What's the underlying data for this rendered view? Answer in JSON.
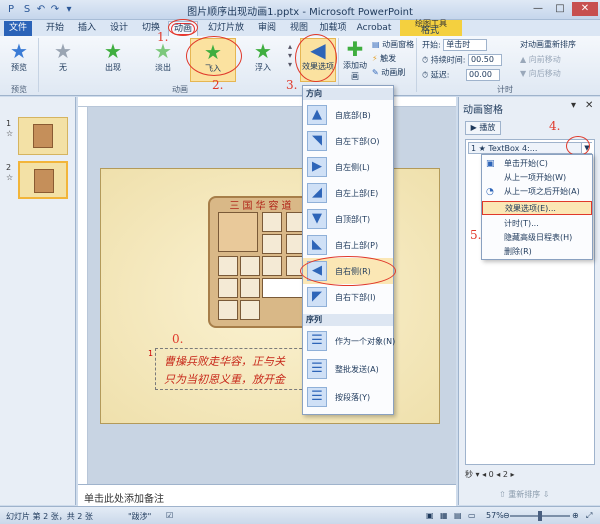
{
  "titlebar": {
    "title": "图片顺序出现动画1.pptx - Microsoft PowerPoint",
    "qat": [
      "P",
      "S",
      "↶",
      "↷",
      "▾"
    ],
    "window_controls": [
      "—",
      "□",
      "✕"
    ]
  },
  "tabs": {
    "file": "文件",
    "items": [
      "开始",
      "插入",
      "设计",
      "切换",
      "动画",
      "幻灯片放映",
      "审阅",
      "视图",
      "加载项",
      "Acrobat",
      "格式"
    ],
    "tool_group": "绘图工具"
  },
  "ribbon": {
    "preview": "预览",
    "preview_group": "预览",
    "effects": [
      "无",
      "出现",
      "淡出",
      "飞入",
      "浮入"
    ],
    "effect_options": "效果选项",
    "add_animation": "添加动画",
    "animation_group": "动画",
    "advanced": [
      "动画窗格",
      "触发",
      "动画刷"
    ],
    "timing": {
      "start_label": "开始:",
      "start_value": "单击时",
      "duration_label": "持续时间:",
      "duration_value": "00.50",
      "delay_label": "延迟:",
      "delay_value": "00.00",
      "group": "计时"
    },
    "reorder": {
      "title": "对动画重新排序",
      "earlier": "向前移动",
      "later": "向后移动"
    }
  },
  "annotations": {
    "n1": "1.",
    "n2": "2.",
    "n3": "3.",
    "n4": "4.",
    "n5": "5.",
    "n0": "0."
  },
  "slides": {
    "thumbs": [
      {
        "num": "1",
        "star": "☆"
      },
      {
        "num": "2",
        "star": "☆"
      }
    ]
  },
  "slide": {
    "puzzle_title": "三国华容道",
    "text_line1": "曹操兵败走华容，正与关",
    "text_line2": "只为当初恩义重，放开金",
    "text_index": "1"
  },
  "dropdown": {
    "direction_head": "方向",
    "directions": [
      {
        "label": "自底部(B)",
        "icon": "arrow-up-icon",
        "glyph": "▲"
      },
      {
        "label": "自左下部(O)",
        "icon": "arrow-up-right-icon",
        "glyph": "◥"
      },
      {
        "label": "自左侧(L)",
        "icon": "arrow-right-icon",
        "glyph": "▶"
      },
      {
        "label": "自左上部(E)",
        "icon": "arrow-down-right-icon",
        "glyph": "◢"
      },
      {
        "label": "自顶部(T)",
        "icon": "arrow-down-icon",
        "glyph": "▼"
      },
      {
        "label": "自右上部(P)",
        "icon": "arrow-down-left-icon",
        "glyph": "◣"
      },
      {
        "label": "自右侧(R)",
        "icon": "arrow-left-icon",
        "glyph": "◀"
      },
      {
        "label": "自右下部(I)",
        "icon": "arrow-up-left-icon",
        "glyph": "◤"
      }
    ],
    "sequence_head": "序列",
    "sequences": [
      {
        "label": "作为一个对象(N)",
        "icon": "lines-icon",
        "glyph": "☰"
      },
      {
        "label": "整批发送(A)",
        "icon": "lines-icon",
        "glyph": "☰"
      },
      {
        "label": "按段落(Y)",
        "icon": "lines-icon",
        "glyph": "☰"
      }
    ]
  },
  "anim_pane": {
    "title": "动画窗格",
    "play": "▶ 播放",
    "item": "1 ★ TextBox 4:...",
    "context_menu": [
      {
        "label": "单击开始(C)",
        "glyph": "🖱"
      },
      {
        "label": "从上一项开始(W)",
        "glyph": ""
      },
      {
        "label": "从上一项之后开始(A)",
        "glyph": "◔"
      },
      {
        "label": "效果选项(E)...",
        "glyph": ""
      },
      {
        "label": "计时(T)...",
        "glyph": ""
      },
      {
        "label": "隐藏高级日程表(H)",
        "glyph": ""
      },
      {
        "label": "删除(R)",
        "glyph": ""
      }
    ],
    "seconds": "秒 ▾  ◂ 0  ◂  2  ▸",
    "reorder": "⇧ 重新排序 ⇩"
  },
  "notes": {
    "placeholder": "单击此处添加备注"
  },
  "statusbar": {
    "slide_info": "幻灯片 第 2 张，共 2 张",
    "theme": "\"跋涉\"",
    "zoom": "57%"
  }
}
